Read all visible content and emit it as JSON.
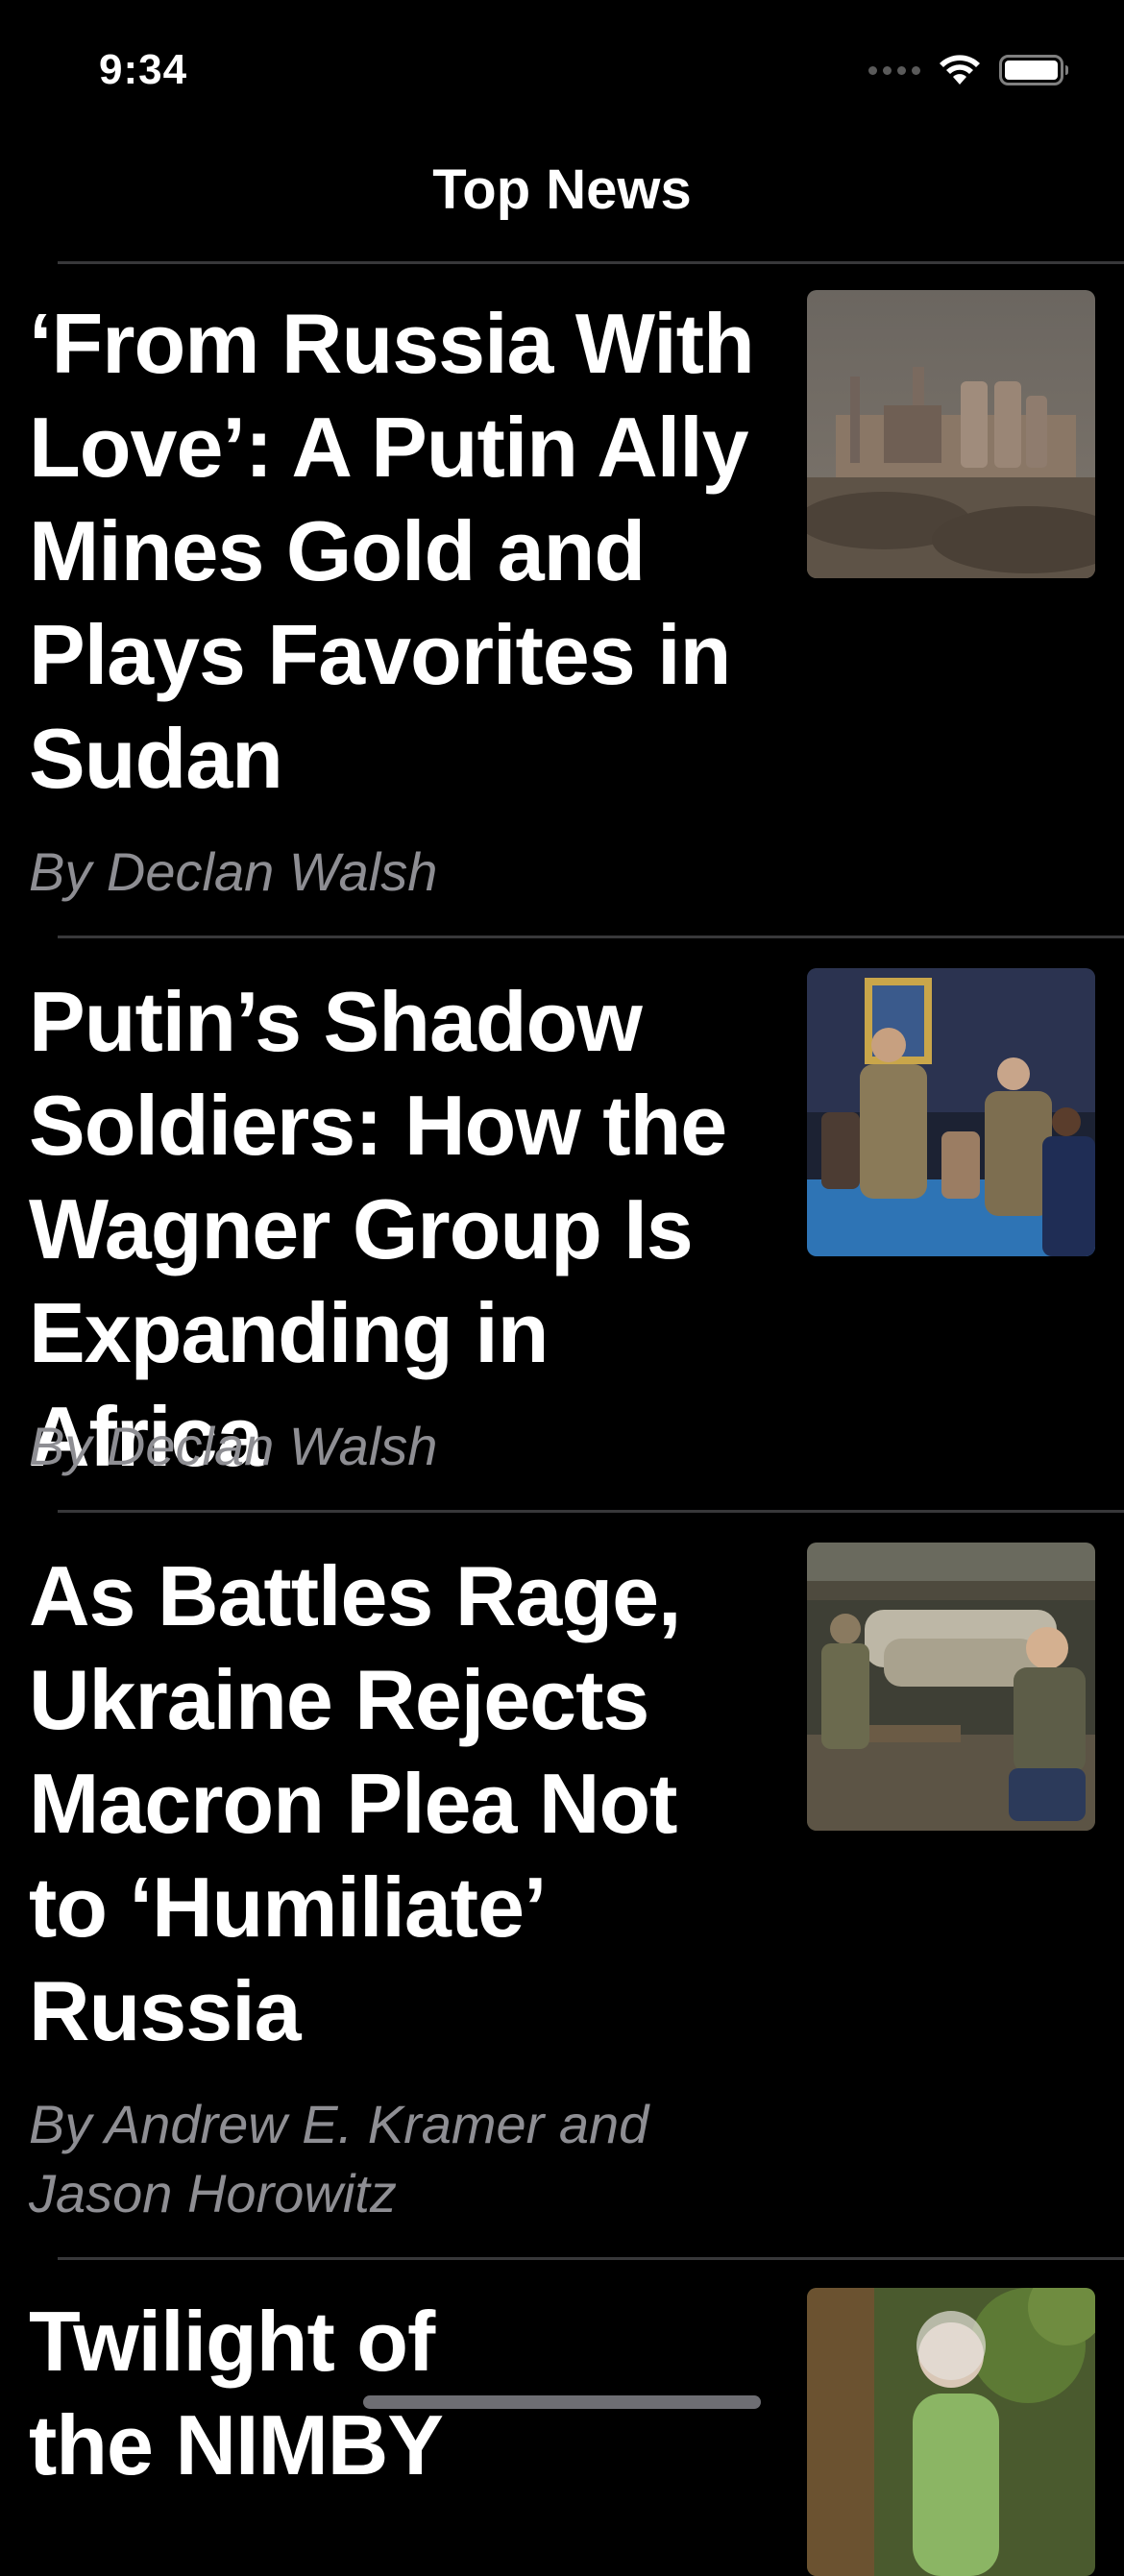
{
  "status_bar": {
    "time": "9:34",
    "icons": [
      "cellular-dots-icon",
      "wifi-icon",
      "battery-icon"
    ]
  },
  "nav": {
    "title": "Top News"
  },
  "articles": [
    {
      "headline": "‘From Russia With\nLove’: A Putin Ally\nMines Gold and\nPlays Favorites in\nSudan",
      "byline": "By Declan Walsh",
      "thumbnail": "industrial-plant-photo"
    },
    {
      "headline": "Putin’s Shadow\nSoldiers: How the\nWagner Group Is\nExpanding in Africa",
      "byline": "By Declan Walsh",
      "thumbnail": "soldiers-at-event-photo"
    },
    {
      "headline": "As Battles Rage,\nUkraine Rejects\nMacron Plea Not\nto ‘Humiliate’\nRussia",
      "byline": "By Andrew E. Kramer and\nJason Horowitz",
      "thumbnail": "soldiers-in-bunker-photo"
    },
    {
      "headline": "Twilight of\nthe NIMBY",
      "byline": "",
      "thumbnail": "woman-in-garden-photo"
    }
  ],
  "colors": {
    "background": "#000000",
    "text": "#ffffff",
    "byline": "#8e8e93",
    "separator": "#38383a"
  }
}
